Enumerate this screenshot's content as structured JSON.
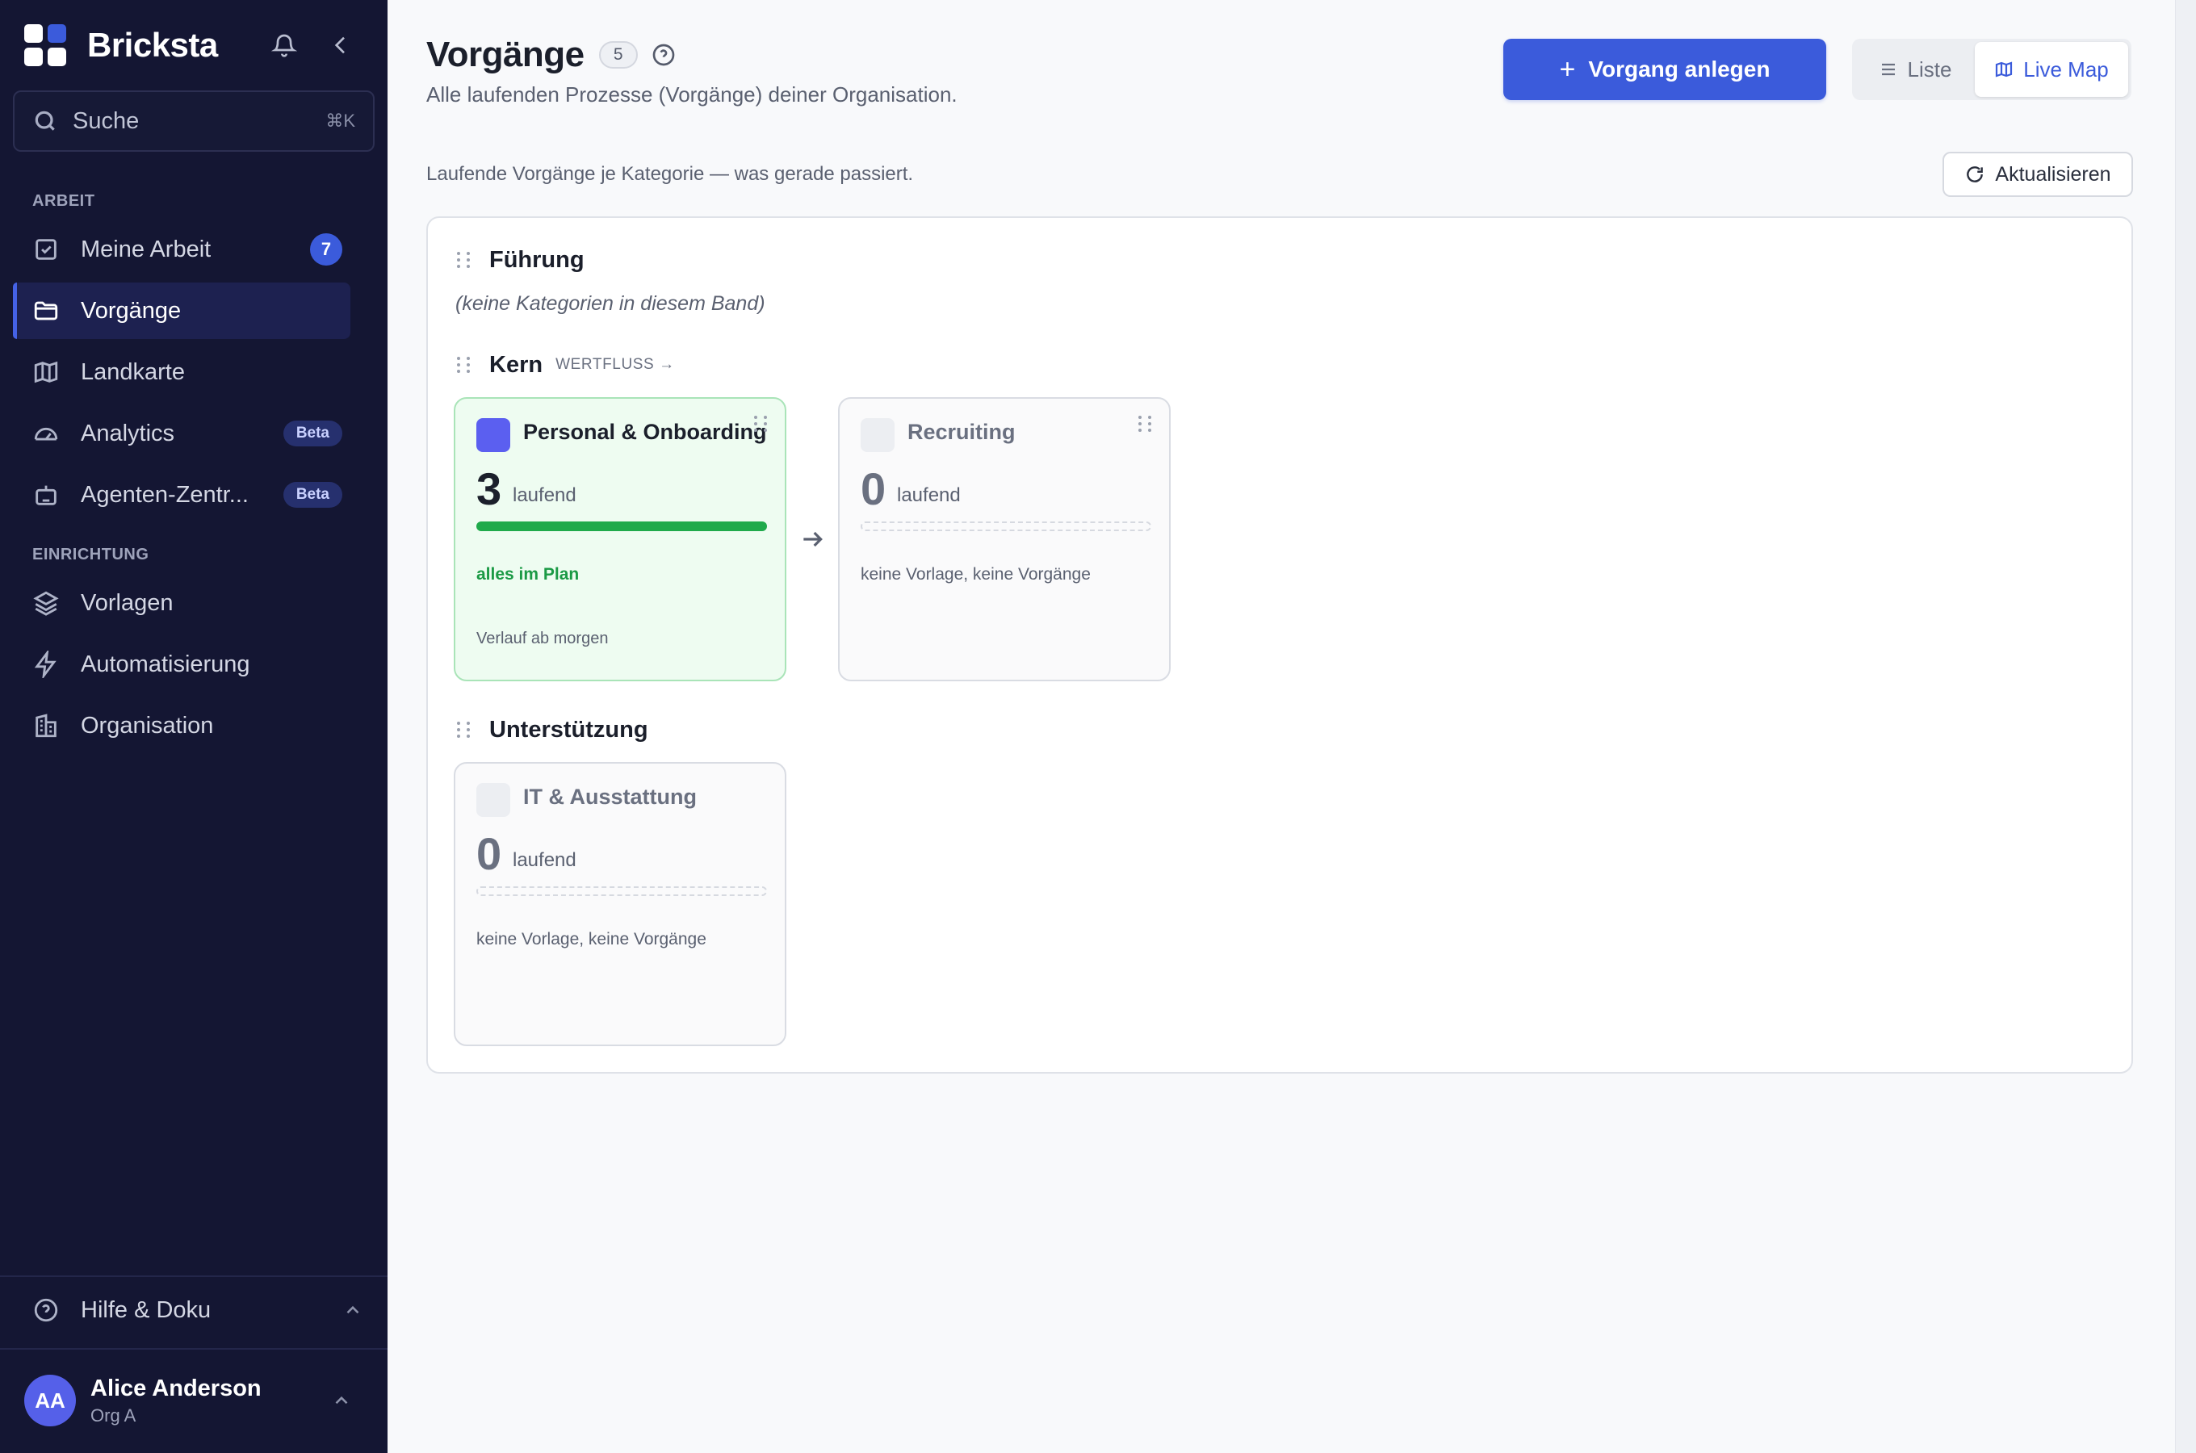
{
  "app": {
    "name": "Bricksta"
  },
  "sidebar": {
    "search": {
      "label": "Suche",
      "shortcut": "⌘K"
    },
    "sections": [
      {
        "label": "ARBEIT"
      },
      {
        "label": "EINRICHTUNG"
      }
    ],
    "items": [
      {
        "label": "Meine Arbeit",
        "badge": "7",
        "icon": "check-square-icon"
      },
      {
        "label": "Vorgänge",
        "active": true,
        "icon": "folder-icon"
      },
      {
        "label": "Landkarte",
        "icon": "map-icon"
      },
      {
        "label": "Analytics",
        "badge": "Beta",
        "icon": "gauge-icon"
      },
      {
        "label": "Agenten-Zentr...",
        "badge": "Beta",
        "icon": "robot-icon"
      },
      {
        "label": "Vorlagen",
        "icon": "layers-icon"
      },
      {
        "label": "Automatisierung",
        "icon": "lightning-icon"
      },
      {
        "label": "Organisation",
        "icon": "building-icon"
      }
    ],
    "help": {
      "label": "Hilfe & Doku"
    },
    "user": {
      "initials": "AA",
      "name": "Alice Anderson",
      "org": "Org A"
    }
  },
  "header": {
    "title": "Vorgänge",
    "count": "5",
    "subtitle": "Alle laufenden Prozesse (Vorgänge) deiner Organisation.",
    "primary_button": {
      "icon": "+",
      "label": "Vorgang anlegen"
    },
    "view_toggle": {
      "list_label": "Liste",
      "map_label": "Live Map",
      "selected": "Live Map"
    }
  },
  "live_map": {
    "caption": "Laufende Vorgänge je Kategorie — was gerade passiert.",
    "refresh_label": "Aktualisieren",
    "bands": [
      {
        "name": "Führung",
        "empty_text": "(keine Kategorien in diesem Band)"
      },
      {
        "name": "Kern",
        "flow_label": "WERTFLUSS →"
      },
      {
        "name": "Unterstützung"
      }
    ],
    "cards": [
      {
        "title": "Personal & Onboarding",
        "count": "3",
        "count_label": "laufend",
        "progress": 1.0,
        "status": "alles im Plan",
        "footer": "Verlauf ab morgen",
        "color": "#5b5ff0"
      },
      {
        "title": "Recruiting",
        "count": "0",
        "count_label": "laufend",
        "status": "keine Vorlage, keine Vorgänge"
      },
      {
        "title": "IT & Ausstattung",
        "count": "0",
        "count_label": "laufend",
        "status": "keine Vorlage, keine Vorgänge"
      }
    ]
  },
  "colors": {
    "sidebar_bg": "#141633",
    "accent": "#3b5bdb",
    "success": "#1faa4b"
  }
}
